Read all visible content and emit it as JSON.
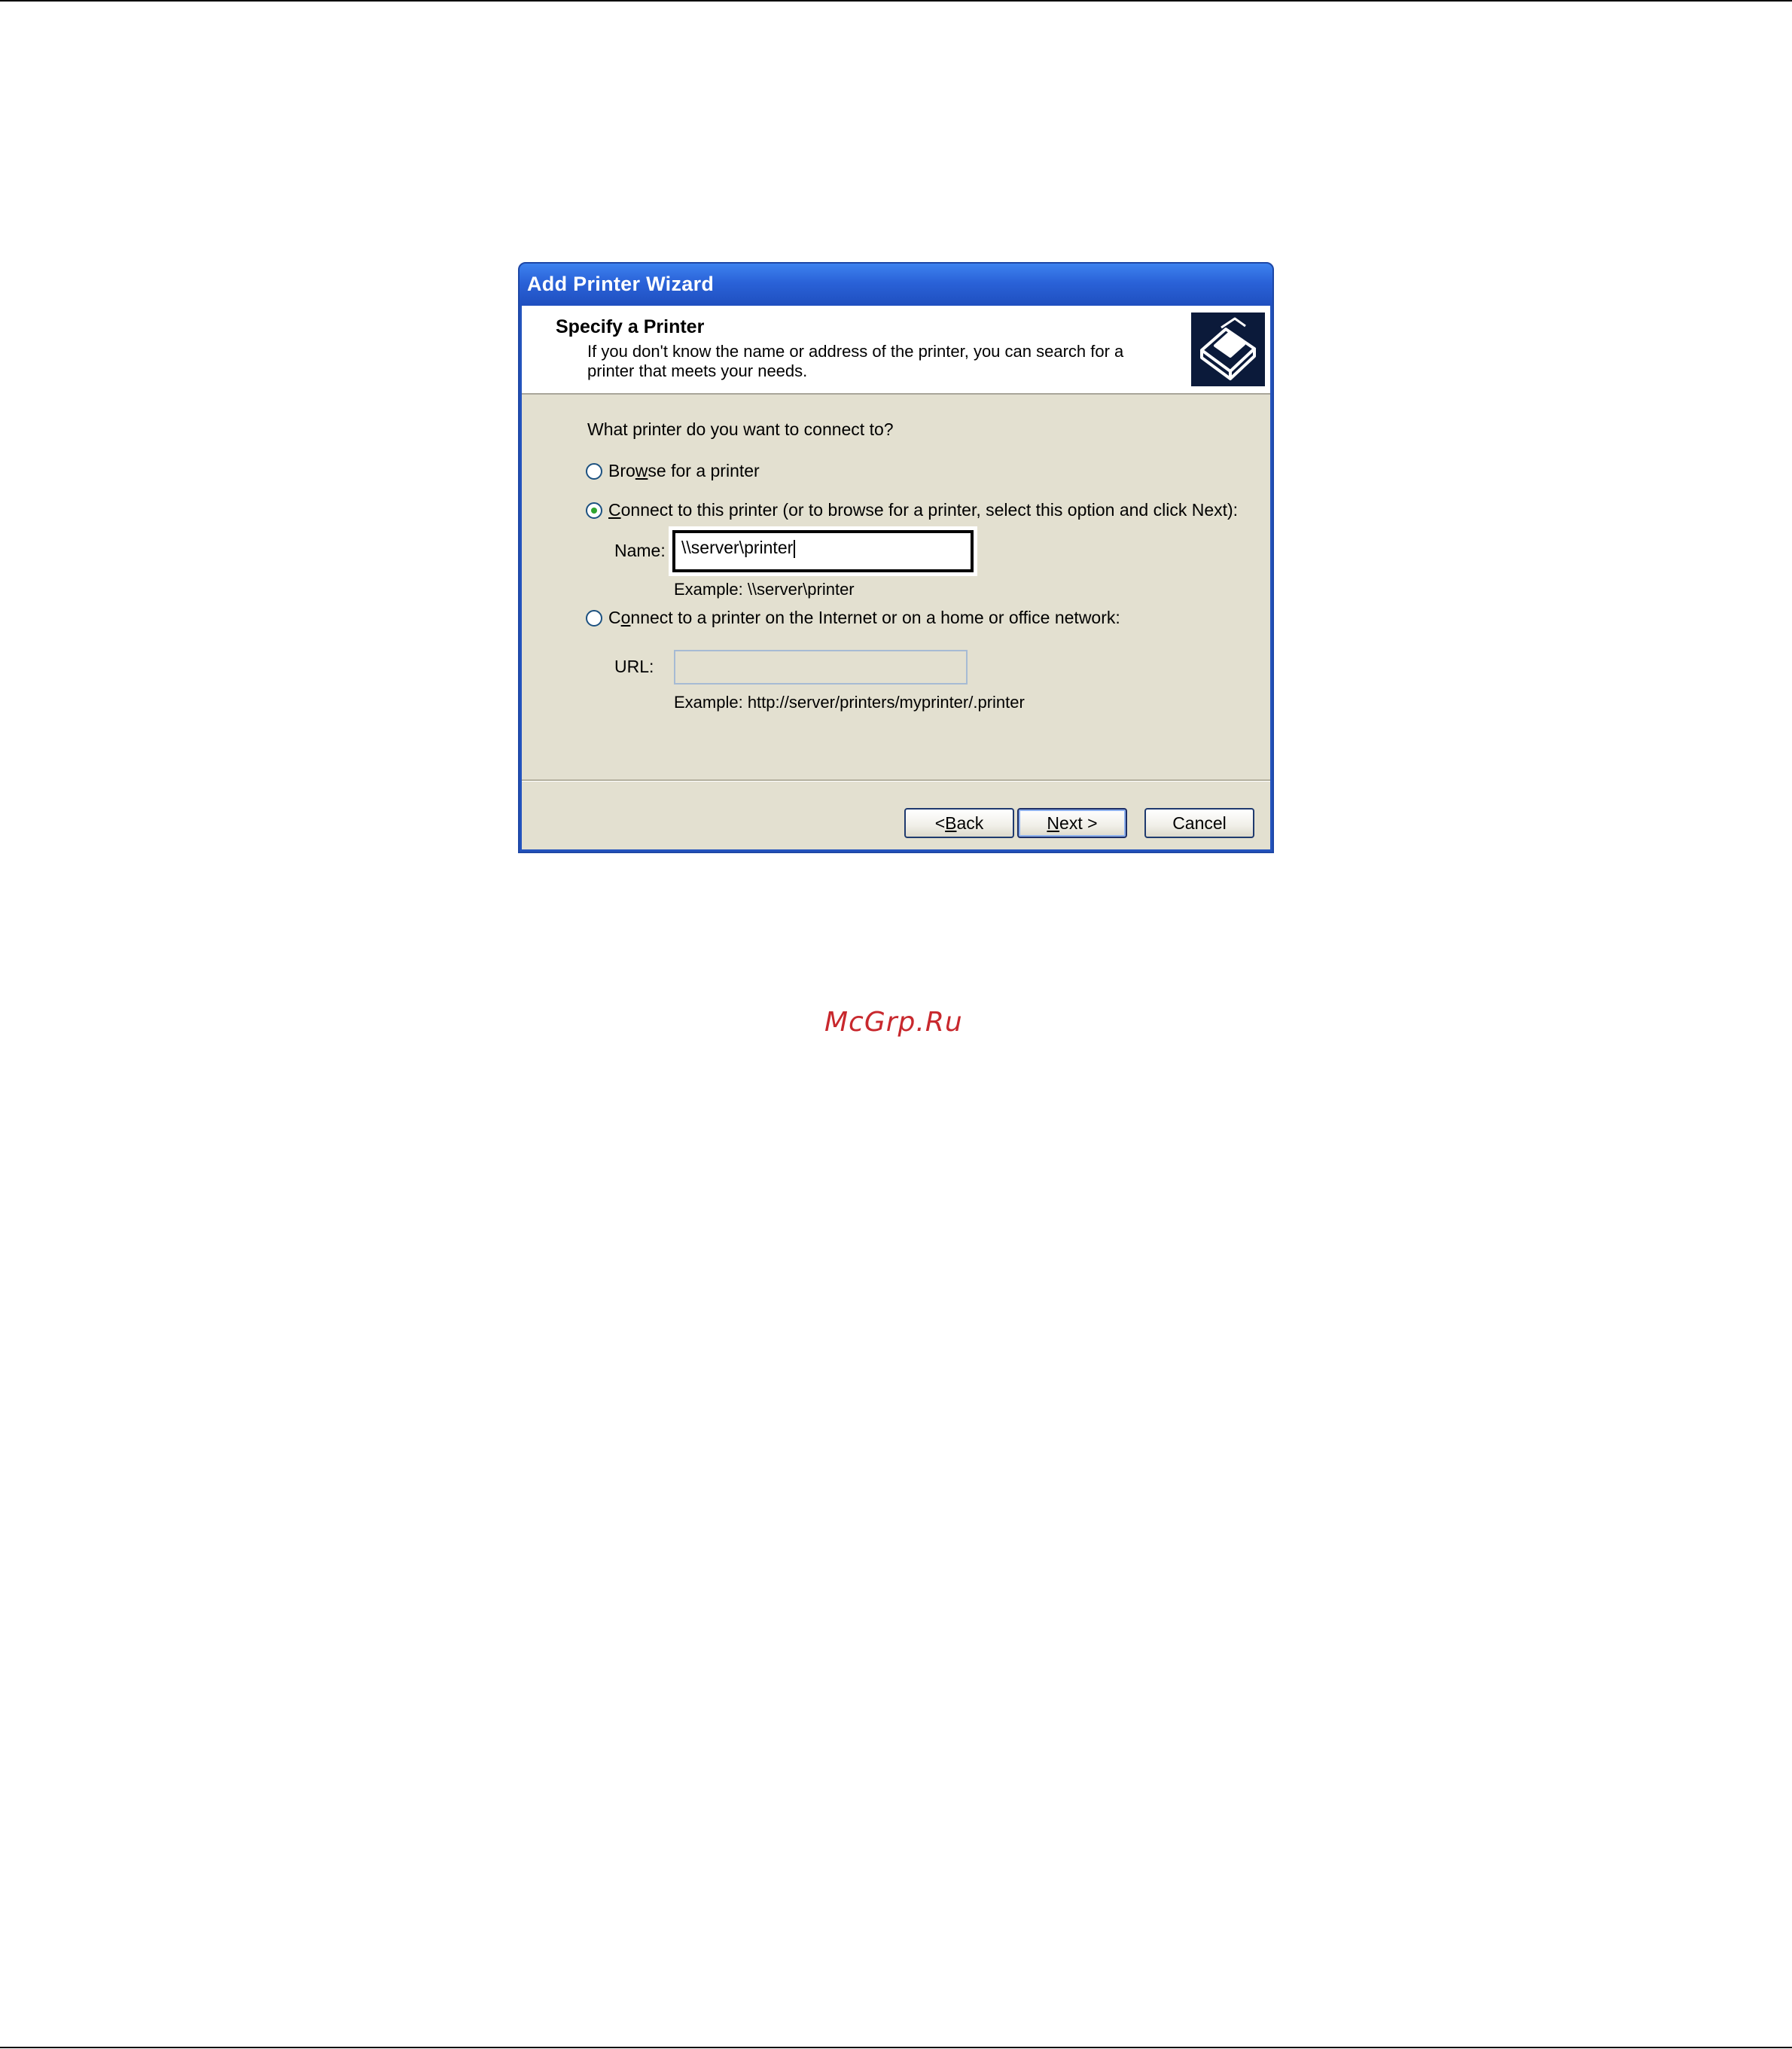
{
  "window": {
    "title": "Add Printer Wizard"
  },
  "header": {
    "title": "Specify a Printer",
    "description": "If you don't know the name or address of the printer, you can search for a printer that meets your needs.",
    "icon": "printer-wizard-icon"
  },
  "body": {
    "prompt": "What printer do you want to connect to?",
    "options": [
      {
        "pre": "Bro",
        "accel": "w",
        "post": "se for a printer",
        "checked": false
      },
      {
        "pre": "",
        "accel": "C",
        "post": "onnect to this printer (or to browse for a printer, select this option and click Next):",
        "checked": true
      },
      {
        "pre": "C",
        "accel": "o",
        "post": "nnect to a printer on the Internet or on a home or office network:",
        "checked": false
      }
    ],
    "name_label": "Name:",
    "name_value": "\\\\server\\printer",
    "name_example": "Example: \\\\server\\printer",
    "url_label": "URL:",
    "url_value": "",
    "url_example": "Example: http://server/printers/myprinter/.printer"
  },
  "buttons": {
    "back_pre": "< ",
    "back_accel": "B",
    "back_post": "ack",
    "next_accel": "N",
    "next_post": "ext >",
    "cancel": "Cancel"
  },
  "watermark": "McGrp.Ru",
  "colors": {
    "titlebar": "#2a62d8",
    "client": "#e3e0d0",
    "radio_dot": "#2fa52f",
    "watermark": "#c8282d"
  }
}
